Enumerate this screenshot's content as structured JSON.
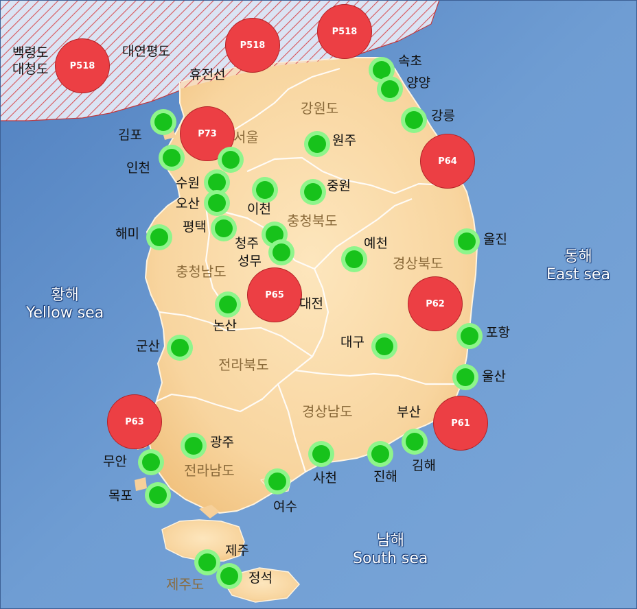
{
  "colors": {
    "sea": "#5d8cc6",
    "land": "#f7d39c",
    "land_border": "#ffffff",
    "restricted_hatch": "#d8555a",
    "zone_fill": "#ec3f44",
    "station_fill": "#17c21b",
    "station_ring": "#8ef58b"
  },
  "seas": {
    "yellow": {
      "ko": "황해",
      "en": "Yellow sea"
    },
    "east": {
      "ko": "동해",
      "en": "East sea"
    },
    "south": {
      "ko": "남해",
      "en": "South sea"
    }
  },
  "provinces": {
    "gangwon": "강원도",
    "chungbuk": "충청북도",
    "chungnam": "충청남도",
    "gyeongbuk": "경상북도",
    "jeonbuk": "전라북도",
    "gyeongnam": "경상남도",
    "jeonnam": "전라남도",
    "jeju": "제주도"
  },
  "place_labels": {
    "baengnyeong": "백령도",
    "daecheong": "대청도",
    "yeonpyeong": "대연평도",
    "hyujeonseon": "휴전선",
    "seoul": "서울"
  },
  "zones": [
    {
      "id": "P518",
      "icon": "warning-zone-circle"
    },
    {
      "id": "P518",
      "icon": "warning-zone-circle"
    },
    {
      "id": "P518",
      "icon": "warning-zone-circle"
    },
    {
      "id": "P73",
      "icon": "warning-zone-circle"
    },
    {
      "id": "P64",
      "icon": "warning-zone-circle"
    },
    {
      "id": "P65",
      "icon": "warning-zone-circle"
    },
    {
      "id": "P62",
      "icon": "warning-zone-circle"
    },
    {
      "id": "P63",
      "icon": "warning-zone-circle"
    },
    {
      "id": "P61",
      "icon": "warning-zone-circle"
    }
  ],
  "stations": [
    {
      "name": "속초"
    },
    {
      "name": "양양"
    },
    {
      "name": "강릉"
    },
    {
      "name": "김포"
    },
    {
      "name": "인천"
    },
    {
      "name": "원주"
    },
    {
      "name": "수원"
    },
    {
      "name": "오산"
    },
    {
      "name": "이천"
    },
    {
      "name": "중원"
    },
    {
      "name": "평택"
    },
    {
      "name": "해미"
    },
    {
      "name": "청주"
    },
    {
      "name": "성무"
    },
    {
      "name": "예천"
    },
    {
      "name": "울진"
    },
    {
      "name": "대전"
    },
    {
      "name": "논산"
    },
    {
      "name": "포항"
    },
    {
      "name": "대구"
    },
    {
      "name": "군산"
    },
    {
      "name": "울산"
    },
    {
      "name": "부산"
    },
    {
      "name": "김해"
    },
    {
      "name": "광주"
    },
    {
      "name": "무안"
    },
    {
      "name": "사천"
    },
    {
      "name": "진해"
    },
    {
      "name": "목포"
    },
    {
      "name": "여수"
    },
    {
      "name": "제주"
    },
    {
      "name": "정석"
    }
  ]
}
